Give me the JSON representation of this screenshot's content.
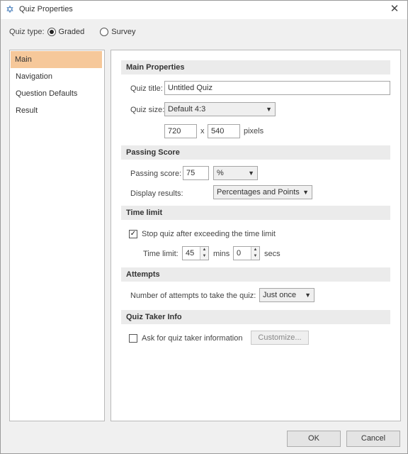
{
  "window": {
    "title": "Quiz Properties",
    "app_icon": "star-of-david-icon",
    "close_glyph": "✕"
  },
  "quiz_type": {
    "label": "Quiz type:",
    "options": [
      {
        "label": "Graded",
        "selected": true
      },
      {
        "label": "Survey",
        "selected": false
      }
    ]
  },
  "sidebar": {
    "items": [
      {
        "label": "Main",
        "active": true
      },
      {
        "label": "Navigation",
        "active": false
      },
      {
        "label": "Question Defaults",
        "active": false
      },
      {
        "label": "Result",
        "active": false
      }
    ]
  },
  "main_properties": {
    "header": "Main Properties",
    "quiz_title_label": "Quiz title:",
    "quiz_title_value": "Untitled Quiz",
    "quiz_size_label": "Quiz size:",
    "quiz_size_value": "Default 4:3",
    "width_value": "720",
    "times": "x",
    "height_value": "540",
    "pixels_label": "pixels"
  },
  "passing_score": {
    "header": "Passing Score",
    "passing_score_label": "Passing score:",
    "passing_score_value": "75",
    "unit_value": "%",
    "display_results_label": "Display results:",
    "display_results_value": "Percentages and Points"
  },
  "time_limit": {
    "header": "Time limit",
    "stop_quiz_label": "Stop quiz after exceeding the time limit",
    "stop_quiz_checked": true,
    "time_limit_label": "Time limit:",
    "minutes_value": "45",
    "mins_label": "mins",
    "seconds_value": "0",
    "secs_label": "secs"
  },
  "attempts": {
    "header": "Attempts",
    "attempts_label": "Number of attempts to take the quiz:",
    "attempts_value": "Just once"
  },
  "quiz_taker_info": {
    "header": "Quiz Taker Info",
    "ask_label": "Ask for quiz taker information",
    "ask_checked": false,
    "customize_label": "Customize..."
  },
  "buttons": {
    "ok": "OK",
    "cancel": "Cancel"
  },
  "colors": {
    "active_sidebar": "#f6c89a",
    "section_header": "#ebebeb",
    "accent_icon": "#2f6db3"
  }
}
